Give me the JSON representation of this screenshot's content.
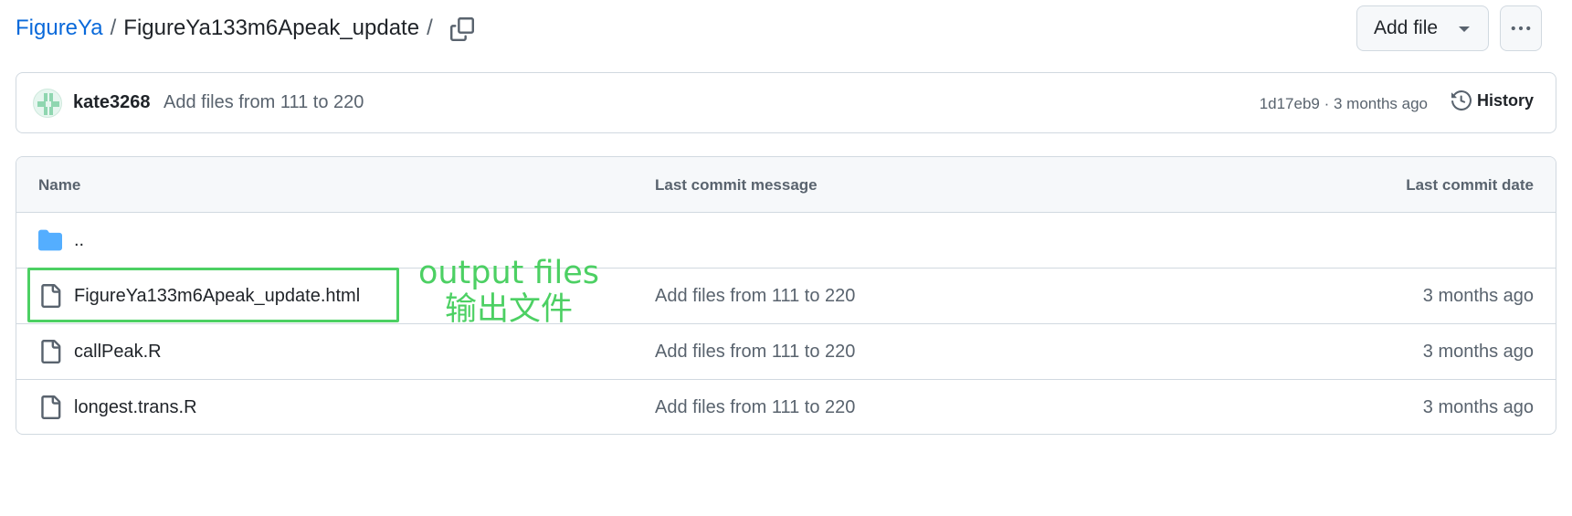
{
  "breadcrumb": {
    "owner": "FigureYa",
    "sep1": "/",
    "repo": "FigureYa133m6Apeak_update",
    "sep2": "/"
  },
  "header": {
    "add_file_label": "Add file",
    "more_icon": "kebab-horizontal-icon",
    "copy_icon": "copy-icon"
  },
  "commit": {
    "author": "kate3268",
    "message": "Add files from 111 to 220",
    "meta": "1d17eb9 · 3 months ago",
    "history_label": "History"
  },
  "table": {
    "columns": [
      "Name",
      "Last commit message",
      "Last commit date"
    ],
    "rows": [
      {
        "name": "..",
        "type": "folder",
        "message": "",
        "date": ""
      },
      {
        "name": "FigureYa133m6Apeak_update.html",
        "type": "file",
        "message": "Add files from 111 to 220",
        "date": "3 months ago"
      },
      {
        "name": "callPeak.R",
        "type": "file",
        "message": "Add files from 111 to 220",
        "date": "3 months ago"
      },
      {
        "name": "longest.trans.R",
        "type": "file",
        "message": "Add files from 111 to 220",
        "date": "3 months ago"
      }
    ]
  },
  "annotation": {
    "line1": "output files",
    "line2": "输出文件",
    "color": "#4cd063"
  },
  "colors": {
    "link": "#0969da",
    "border": "#d1d9e0",
    "muted": "#59636e",
    "folder": "#54aeff"
  }
}
